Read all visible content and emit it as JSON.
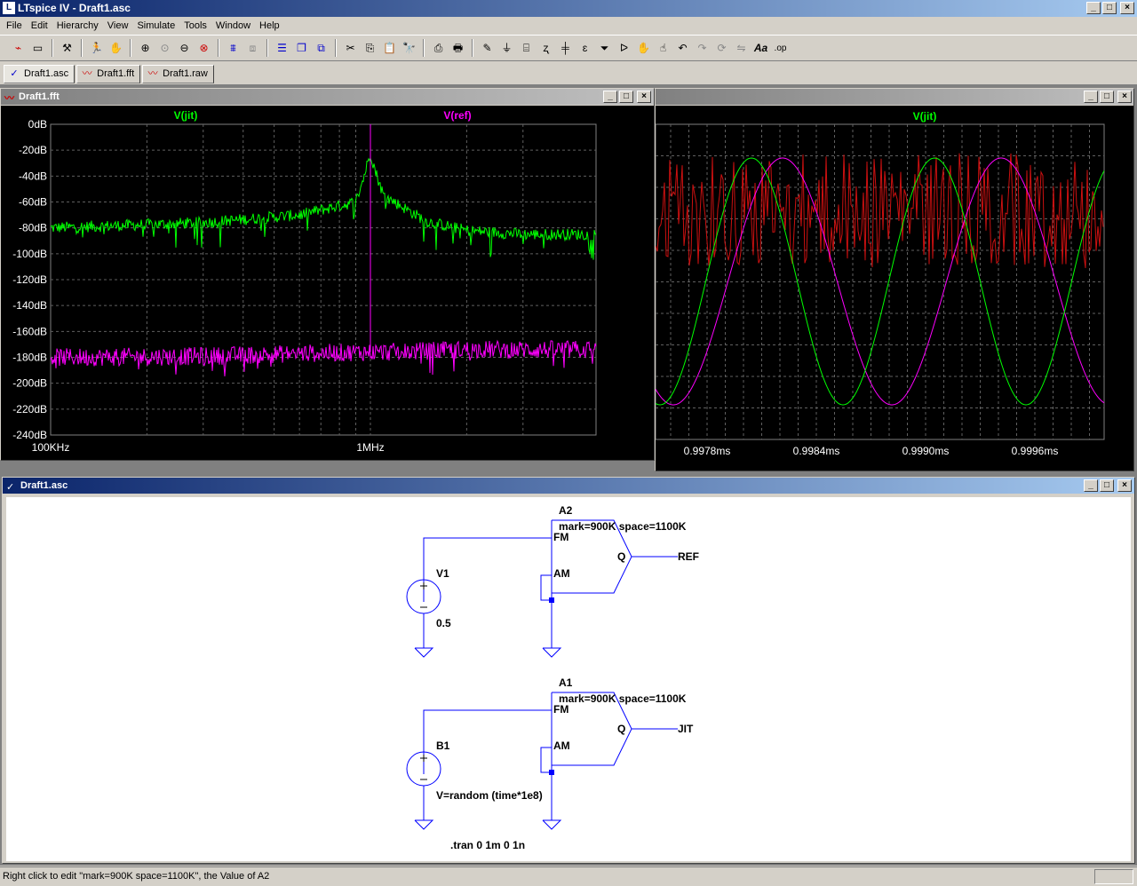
{
  "app": {
    "title": "LTspice IV - Draft1.asc",
    "icon": "ltspice-icon"
  },
  "menu": [
    "File",
    "Edit",
    "Hierarchy",
    "View",
    "Simulate",
    "Tools",
    "Window",
    "Help"
  ],
  "toolbar_icons": [
    "new-schematic-icon",
    "open-icon",
    "control-panel-icon",
    "run-icon",
    "halt-icon",
    "zoom-in-icon",
    "pan-icon",
    "zoom-out-icon",
    "zoom-cancel-icon",
    "autorange-icon",
    "fit-icon",
    "tile-horizontal-icon",
    "cascade-icon",
    "close-all-icon",
    "cut-icon",
    "copy-icon",
    "paste-icon",
    "find-icon",
    "print-setup-icon",
    "print-icon",
    "draw-wire-icon",
    "ground-icon",
    "label-net-icon",
    "resistor-icon",
    "capacitor-icon",
    "inductor-icon",
    "diode-icon",
    "component-icon",
    "move-icon",
    "drag-icon",
    "undo-icon",
    "redo-icon",
    "rotate-icon",
    "mirror-icon",
    "text-icon",
    "spice-directive-icon"
  ],
  "tabs": [
    {
      "label": "Draft1.asc",
      "icon": "schematic-icon",
      "active": true
    },
    {
      "label": "Draft1.fft",
      "icon": "waveform-icon",
      "active": false
    },
    {
      "label": "Draft1.raw",
      "icon": "waveform-icon",
      "active": false
    }
  ],
  "fft_window": {
    "title": "Draft1.fft",
    "trace_labels": [
      {
        "name": "V(jit)",
        "color": "#00ff00"
      },
      {
        "name": "V(ref)",
        "color": "#ff00ff"
      }
    ],
    "y_ticks": [
      "0dB",
      "-20dB",
      "-40dB",
      "-60dB",
      "-80dB",
      "-100dB",
      "-120dB",
      "-140dB",
      "-160dB",
      "-180dB",
      "-200dB",
      "-220dB",
      "-240dB"
    ],
    "x_ticks": [
      "100KHz",
      "1MHz"
    ]
  },
  "raw_window": {
    "trace_label": "V(jit)",
    "trace_color": "#00ff00",
    "x_ticks": [
      "0.9978ms",
      "0.9984ms",
      "0.9990ms",
      "0.9996ms"
    ],
    "ref_color": "#ff00ff",
    "noise_color": "#cc1010"
  },
  "chart_data": [
    {
      "type": "line",
      "xlabel": "",
      "ylabel": "",
      "x_scale": "log",
      "xlim": [
        "100KHz",
        "3MHz"
      ],
      "ylim": [
        -240,
        0
      ],
      "y_unit": "dB",
      "grid": true,
      "series": [
        {
          "name": "V(jit)",
          "x_khz": [
            100,
            300,
            600,
            900,
            1000,
            1100,
            1500,
            2000,
            3000
          ],
          "values_db": [
            -80,
            -76,
            -70,
            -60,
            -25,
            -55,
            -75,
            -82,
            -85
          ]
        },
        {
          "name": "V(ref)",
          "x_khz": [
            100,
            300,
            600,
            900,
            1000,
            1100,
            1500,
            2000,
            3000
          ],
          "values_db": [
            -180,
            -179,
            -177,
            -176,
            0,
            -176,
            -175,
            -174,
            -174
          ]
        }
      ]
    },
    {
      "type": "line",
      "xlabel": "",
      "ylabel": "",
      "xlim": [
        "0.9975ms",
        "1.0000ms"
      ],
      "grid": true,
      "series": [
        {
          "name": "V(jit)",
          "x_ms": [
            0.9978,
            0.9984,
            0.999,
            0.9996
          ],
          "frequency": "1MHz (jittered)"
        },
        {
          "name": "V(ref)",
          "frequency": "1MHz"
        }
      ]
    }
  ],
  "schematic_window": {
    "title": "Draft1.asc",
    "components": {
      "A2": {
        "name": "A2",
        "params": "mark=900K space=1100K",
        "pin_fm": "FM",
        "pin_am": "AM",
        "pin_q": "Q",
        "net_out": "REF"
      },
      "V1": {
        "name": "V1",
        "value": "0.5"
      },
      "A1": {
        "name": "A1",
        "params": "mark=900K space=1100K",
        "pin_fm": "FM",
        "pin_am": "AM",
        "pin_q": "Q",
        "net_out": "JIT"
      },
      "B1": {
        "name": "B1",
        "value": "V=random (time*1e8)"
      }
    },
    "directive": ".tran 0 1m 0 1n"
  },
  "status": {
    "text": "Right click to edit \"mark=900K space=1100K\", the Value of A2"
  }
}
